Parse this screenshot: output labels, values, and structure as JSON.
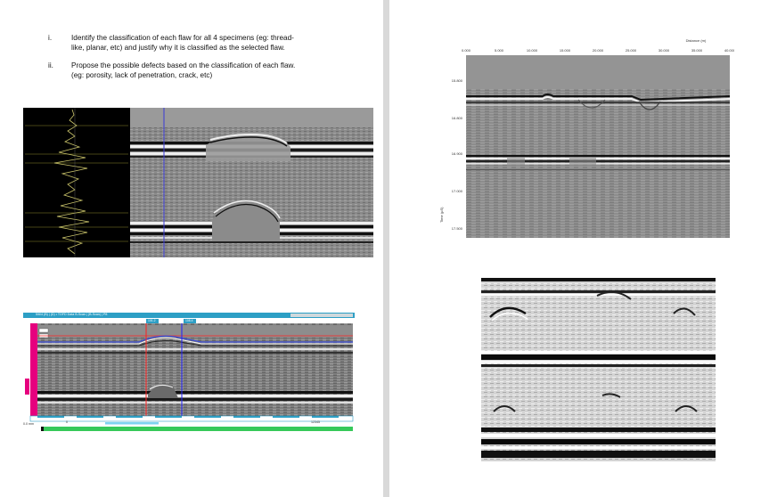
{
  "questions": [
    {
      "num": "i.",
      "lines": [
        "Identify the classification of each flaw for all 4 specimens (eg: thread-",
        "like, planar, etc) and justify why it is classified as the selected flaw."
      ]
    },
    {
      "num": "ii.",
      "lines": [
        "Propose the possible defects based on the classification of each flaw.",
        "(eg: porosity, lack of penetration, crack, etc)"
      ]
    }
  ],
  "image_tr": {
    "x_title": "Distance (m)",
    "x_ticks": [
      "0.000",
      "5.000",
      "10.000",
      "15.000",
      "20.000",
      "25.000",
      "30.000",
      "35.000",
      "40.000"
    ],
    "y_title": "Time (µS)",
    "y_ticks": [
      "15.800",
      "16.800",
      "16.900",
      "17.000",
      "17.500"
    ]
  },
  "image_bl": {
    "status_text": "5/6/4 (B) | (D) • TOFD Data B-Scan | (B-Scan) | P8",
    "cursor_a": "101.2",
    "cursor_b": "108.4",
    "scale_text": "0.0 mm",
    "bottom_left": "0",
    "bottom_right": "12345"
  }
}
